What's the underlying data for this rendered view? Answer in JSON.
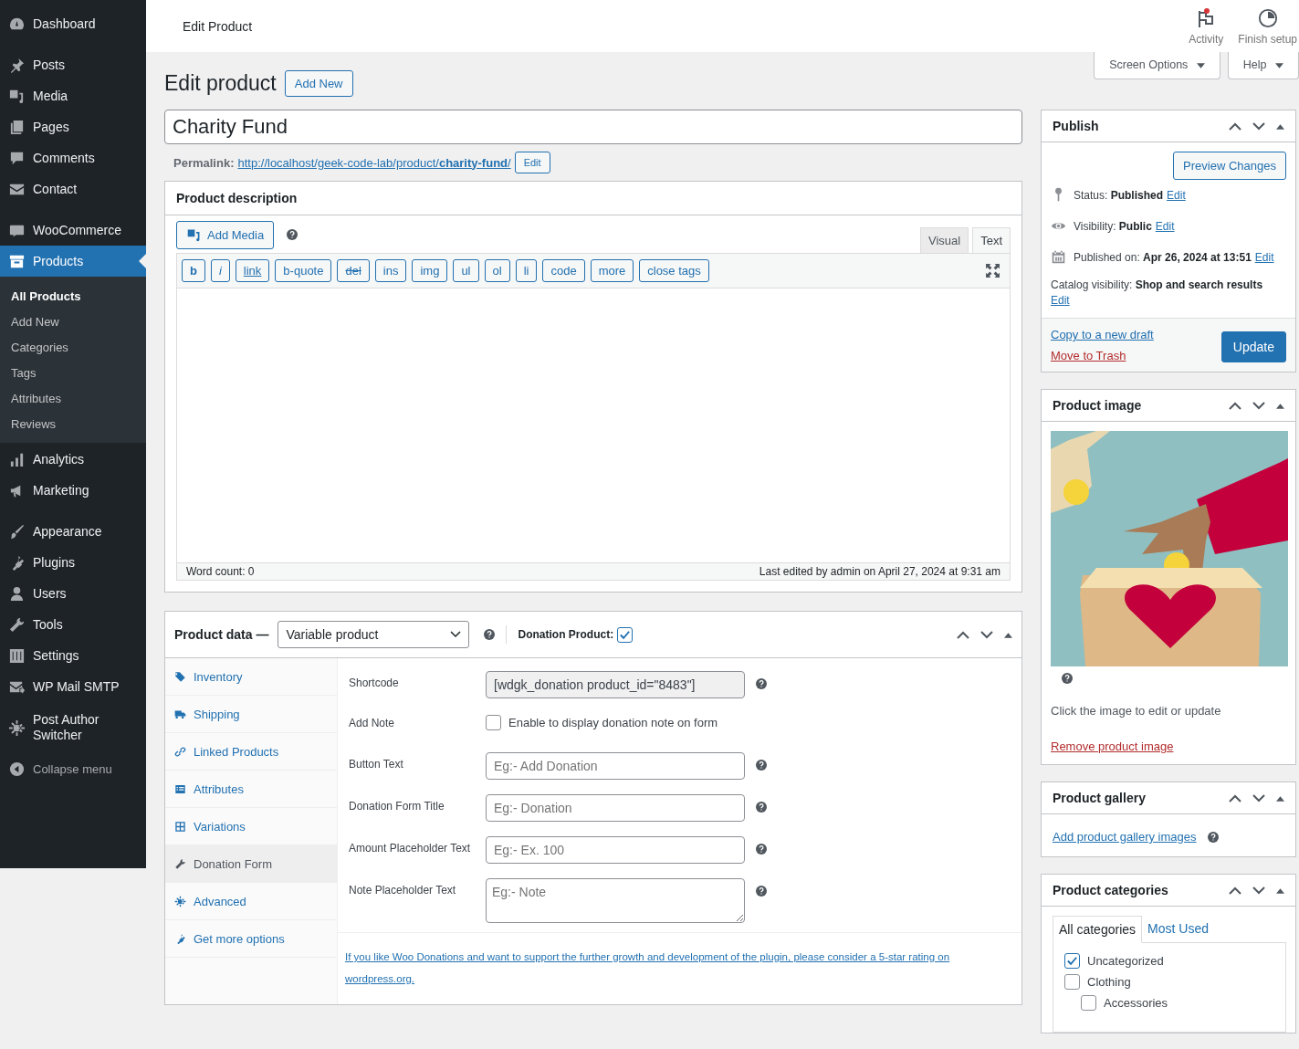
{
  "admin_menu": {
    "groups": [
      [
        {
          "label": "Dashboard",
          "selected": false
        }
      ],
      [
        {
          "label": "Posts",
          "selected": false
        },
        {
          "label": "Media",
          "selected": false
        },
        {
          "label": "Pages",
          "selected": false
        },
        {
          "label": "Comments",
          "selected": false
        },
        {
          "label": "Contact",
          "selected": false
        }
      ],
      [
        {
          "label": "WooCommerce",
          "selected": false
        },
        {
          "label": "Products",
          "selected": true,
          "children": [
            {
              "label": "All Products",
              "selected": true
            },
            {
              "label": "Add New",
              "selected": false
            },
            {
              "label": "Categories",
              "selected": false
            },
            {
              "label": "Tags",
              "selected": false
            },
            {
              "label": "Attributes",
              "selected": false
            },
            {
              "label": "Reviews",
              "selected": false
            }
          ]
        },
        {
          "label": "Analytics",
          "selected": false
        },
        {
          "label": "Marketing",
          "selected": false
        }
      ],
      [
        {
          "label": "Appearance",
          "selected": false
        },
        {
          "label": "Plugins",
          "selected": false
        },
        {
          "label": "Users",
          "selected": false
        },
        {
          "label": "Tools",
          "selected": false
        },
        {
          "label": "Settings",
          "selected": false
        },
        {
          "label": "WP Mail SMTP",
          "selected": false
        }
      ],
      [
        {
          "label": "Post Author Switcher",
          "selected": false
        }
      ]
    ],
    "collapse": "Collapse menu"
  },
  "top_bar": {
    "title": "Edit Product",
    "actions": [
      {
        "label": "Activity",
        "unread": true
      },
      {
        "label": "Finish setup",
        "unread": false
      }
    ]
  },
  "screen_tabs": [
    "Screen Options",
    "Help"
  ],
  "heading": "Edit product",
  "add_new": "Add New",
  "title_field": {
    "value": "Charity Fund"
  },
  "permalink": {
    "label": "Permalink:",
    "url": "http://localhost/geek-code-lab/product/**charity-fund**/",
    "edit": "Edit"
  },
  "description_box": {
    "title": "Product description",
    "add_media": "Add Media",
    "editor_tabs": [
      {
        "label": "Visual",
        "selected": false
      },
      {
        "label": "Text",
        "selected": true
      }
    ],
    "quicktags": [
      {
        "label": "b",
        "kind": "bold"
      },
      {
        "label": "i",
        "kind": "italic"
      },
      {
        "label": "link",
        "kind": "underline"
      },
      {
        "label": "b-quote",
        "kind": "plain"
      },
      {
        "label": "del",
        "kind": "strike"
      },
      {
        "label": "ins",
        "kind": "plain"
      },
      {
        "label": "img",
        "kind": "plain"
      },
      {
        "label": "ul",
        "kind": "plain"
      },
      {
        "label": "ol",
        "kind": "plain"
      },
      {
        "label": "li",
        "kind": "plain"
      },
      {
        "label": "code",
        "kind": "plain"
      },
      {
        "label": "more",
        "kind": "plain"
      },
      {
        "label": "close tags",
        "kind": "plain"
      }
    ],
    "word_count": "Word count: 0",
    "last_edited": "Last edited by admin on April 27, 2024 at 9:31 am"
  },
  "product_data": {
    "title": "Product data —",
    "type_select": "Variable product",
    "donation_label": "Donation Product:",
    "donation_checked": true,
    "tabs": [
      {
        "label": "Inventory",
        "selected": false
      },
      {
        "label": "Shipping",
        "selected": false
      },
      {
        "label": "Linked Products",
        "selected": false
      },
      {
        "label": "Attributes",
        "selected": false
      },
      {
        "label": "Variations",
        "selected": false
      },
      {
        "label": "Donation Form",
        "selected": true
      },
      {
        "label": "Advanced",
        "selected": false
      },
      {
        "label": "Get more options",
        "selected": false
      }
    ],
    "fields": [
      {
        "kind": "readonly",
        "label": "Shortcode",
        "value": "[wdgk_donation product_id=\"8483\"]"
      },
      {
        "kind": "checkbox",
        "label": "Add Note",
        "checked": false,
        "text": "Enable to display donation note on form"
      },
      {
        "kind": "input",
        "label": "Button Text",
        "placeholder": "Eg:- Add Donation"
      },
      {
        "kind": "input",
        "label": "Donation Form Title",
        "placeholder": "Eg:- Donation"
      },
      {
        "kind": "input",
        "label": "Amount Placeholder Text",
        "placeholder": "Eg:- Ex. 100"
      },
      {
        "kind": "textarea",
        "label": "Note Placeholder Text",
        "placeholder": "Eg:- Note"
      }
    ],
    "footer_link": "If you like Woo Donations and want to support the further growth and development of the plugin, please consider a 5-star rating on wordpress.org."
  },
  "publish": {
    "title": "Publish",
    "preview": "Preview Changes",
    "rows": [
      {
        "kind": "status",
        "text": "Status: **Published**",
        "edit": "Edit"
      },
      {
        "kind": "visibility",
        "text": "Visibility: **Public**",
        "edit": "Edit"
      },
      {
        "kind": "date",
        "text": "Published on: **Apr 26, 2024 at 13:51**",
        "edit": "Edit"
      }
    ],
    "catalog": {
      "text": "Catalog visibility: **Shop and search results**",
      "edit": "Edit"
    },
    "copy": "Copy to a new draft",
    "trash": "Move to Trash",
    "update": "Update"
  },
  "product_image": {
    "title": "Product image",
    "hint": "Click the image to edit or update",
    "remove": "Remove product image"
  },
  "gallery": {
    "title": "Product gallery",
    "add": "Add product gallery images"
  },
  "categories": {
    "title": "Product categories",
    "tabs": [
      {
        "label": "All categories",
        "selected": true
      },
      {
        "label": "Most Used",
        "selected": false
      }
    ],
    "items": [
      {
        "label": "Uncategorized",
        "checked": true
      },
      {
        "label": "Clothing",
        "checked": false,
        "children": [
          {
            "label": "Accessories",
            "checked": false
          }
        ]
      }
    ]
  }
}
